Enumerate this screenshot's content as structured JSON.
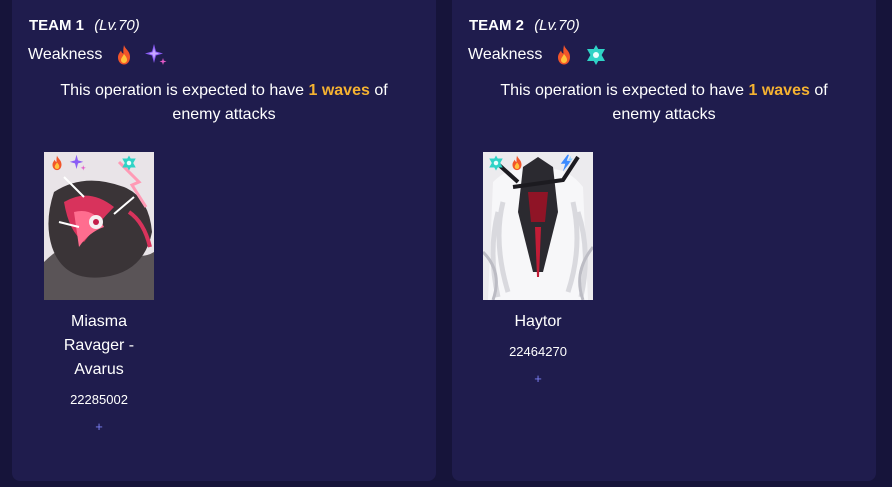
{
  "teams": [
    {
      "name": "TEAM 1",
      "level": "(Lv.70)",
      "weakness_label": "Weakness",
      "weaknesses": [
        "fire-icon",
        "quantum-sparkle-icon"
      ],
      "operation": {
        "prefix": "This operation is expected to have",
        "waves": "1 waves",
        "suffix": "of enemy attacks"
      },
      "enemies": [
        {
          "name": "Miasma Ravager - Avarus",
          "id": "22285002",
          "elements": [
            "fire-icon",
            "quantum-sparkle-icon",
            "ice-icon"
          ],
          "add_label": "+"
        }
      ]
    },
    {
      "name": "TEAM 2",
      "level": "(Lv.70)",
      "weakness_label": "Weakness",
      "weaknesses": [
        "fire-icon",
        "ice-icon"
      ],
      "operation": {
        "prefix": "This operation is expected to have",
        "waves": "1 waves",
        "suffix": "of enemy attacks"
      },
      "enemies": [
        {
          "name": "Haytor",
          "id": "22464270",
          "elements": [
            "ice-icon",
            "fire-icon",
            "lightning-icon"
          ],
          "add_label": "+"
        }
      ]
    }
  ],
  "colors": {
    "background": "#16143a",
    "panel": "#1f1c4d",
    "accent_waves": "#f5b231",
    "add_button": "#7b7ff2"
  }
}
